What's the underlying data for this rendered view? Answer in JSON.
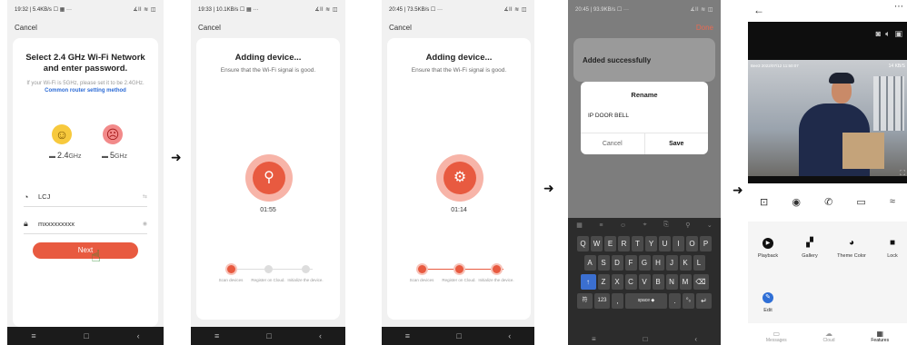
{
  "screen1": {
    "status_left": "19:32 | 5.4KB/s ☐ ▦ ···",
    "status_right": "∡ll ≋ ◫",
    "cancel": "Cancel",
    "title_line1": "Select 2.4 GHz Wi-Fi Network",
    "title_line2": "and enter password.",
    "note": "If your Wi-Fi is 5GHz, please set it to be 2.4GHz.",
    "note_link": "Common router setting method",
    "band_24": "2.4",
    "band_24_unit": "GHz",
    "band_5": "5",
    "band_5_unit": "GHz",
    "wifi_name": "LCJ",
    "wifi_end": "⇆",
    "password": "mxxxxxxxxx",
    "password_end": "◉",
    "next": "Next"
  },
  "screen2": {
    "status_left": "19:33 | 10.1KB/s ☐ ▦ ···",
    "status_right": "∡ll ≋ ◫",
    "cancel": "Cancel",
    "title": "Adding device...",
    "subtitle": "Ensure that the Wi-Fi signal is good.",
    "timer": "01:55",
    "steps": [
      "Scan devices",
      "Register on Cloud.",
      "Initialize the device."
    ]
  },
  "screen3": {
    "status_left": "20:45 | 73.5KB/s ☐ ···",
    "status_right": "∡ll ≋ ◫",
    "cancel": "Cancel",
    "title": "Adding device...",
    "subtitle": "Ensure that the Wi-Fi signal is good.",
    "timer": "01:14",
    "steps": [
      "Scan devices",
      "Register on Cloud.",
      "Initialize the device."
    ]
  },
  "screen4": {
    "status_left": "20:45 | 93.9KB/s ☐ ···",
    "status_right": "∡ll ≋ ◫",
    "done": "Done",
    "added": "Added successfully",
    "dialog_title": "Rename",
    "dialog_value": "IP DOOR BELL",
    "dialog_cancel": "Cancel",
    "dialog_save": "Save",
    "keys_row1": [
      "Q",
      "W",
      "E",
      "R",
      "T",
      "Y",
      "U",
      "I",
      "O",
      "P"
    ],
    "keys_row2": [
      "A",
      "S",
      "D",
      "F",
      "G",
      "H",
      "J",
      "K",
      "L"
    ],
    "keys_row3": [
      "Z",
      "X",
      "C",
      "V",
      "B",
      "N",
      "M"
    ],
    "key_sym": "符",
    "key_num": "123",
    "key_space": "space ◆",
    "key_shift": "↑",
    "key_back": "⌫",
    "key_enter": "↵",
    "key_comma": ",",
    "key_period": ".",
    "key_lang": "⁰₀"
  },
  "screen5": {
    "osd_left": "Bee3 2022/07/12 11:50:07",
    "osd_right": "14 KB/S",
    "features": [
      {
        "label": "Playback",
        "icon": "▶"
      },
      {
        "label": "Gallery",
        "icon": "▞"
      },
      {
        "label": "Theme Color",
        "icon": "◕"
      },
      {
        "label": "Lock",
        "icon": "■"
      },
      {
        "label": "Edit",
        "icon": "✎"
      }
    ],
    "tabs": [
      {
        "label": "Messages",
        "icon": "▭"
      },
      {
        "label": "Cloud",
        "icon": "☁"
      },
      {
        "label": "Features",
        "icon": "▦"
      }
    ]
  },
  "colors": {
    "accent": "#e85a40",
    "link": "#2c6bd6",
    "dim_overlay": "#7d7d7d"
  }
}
